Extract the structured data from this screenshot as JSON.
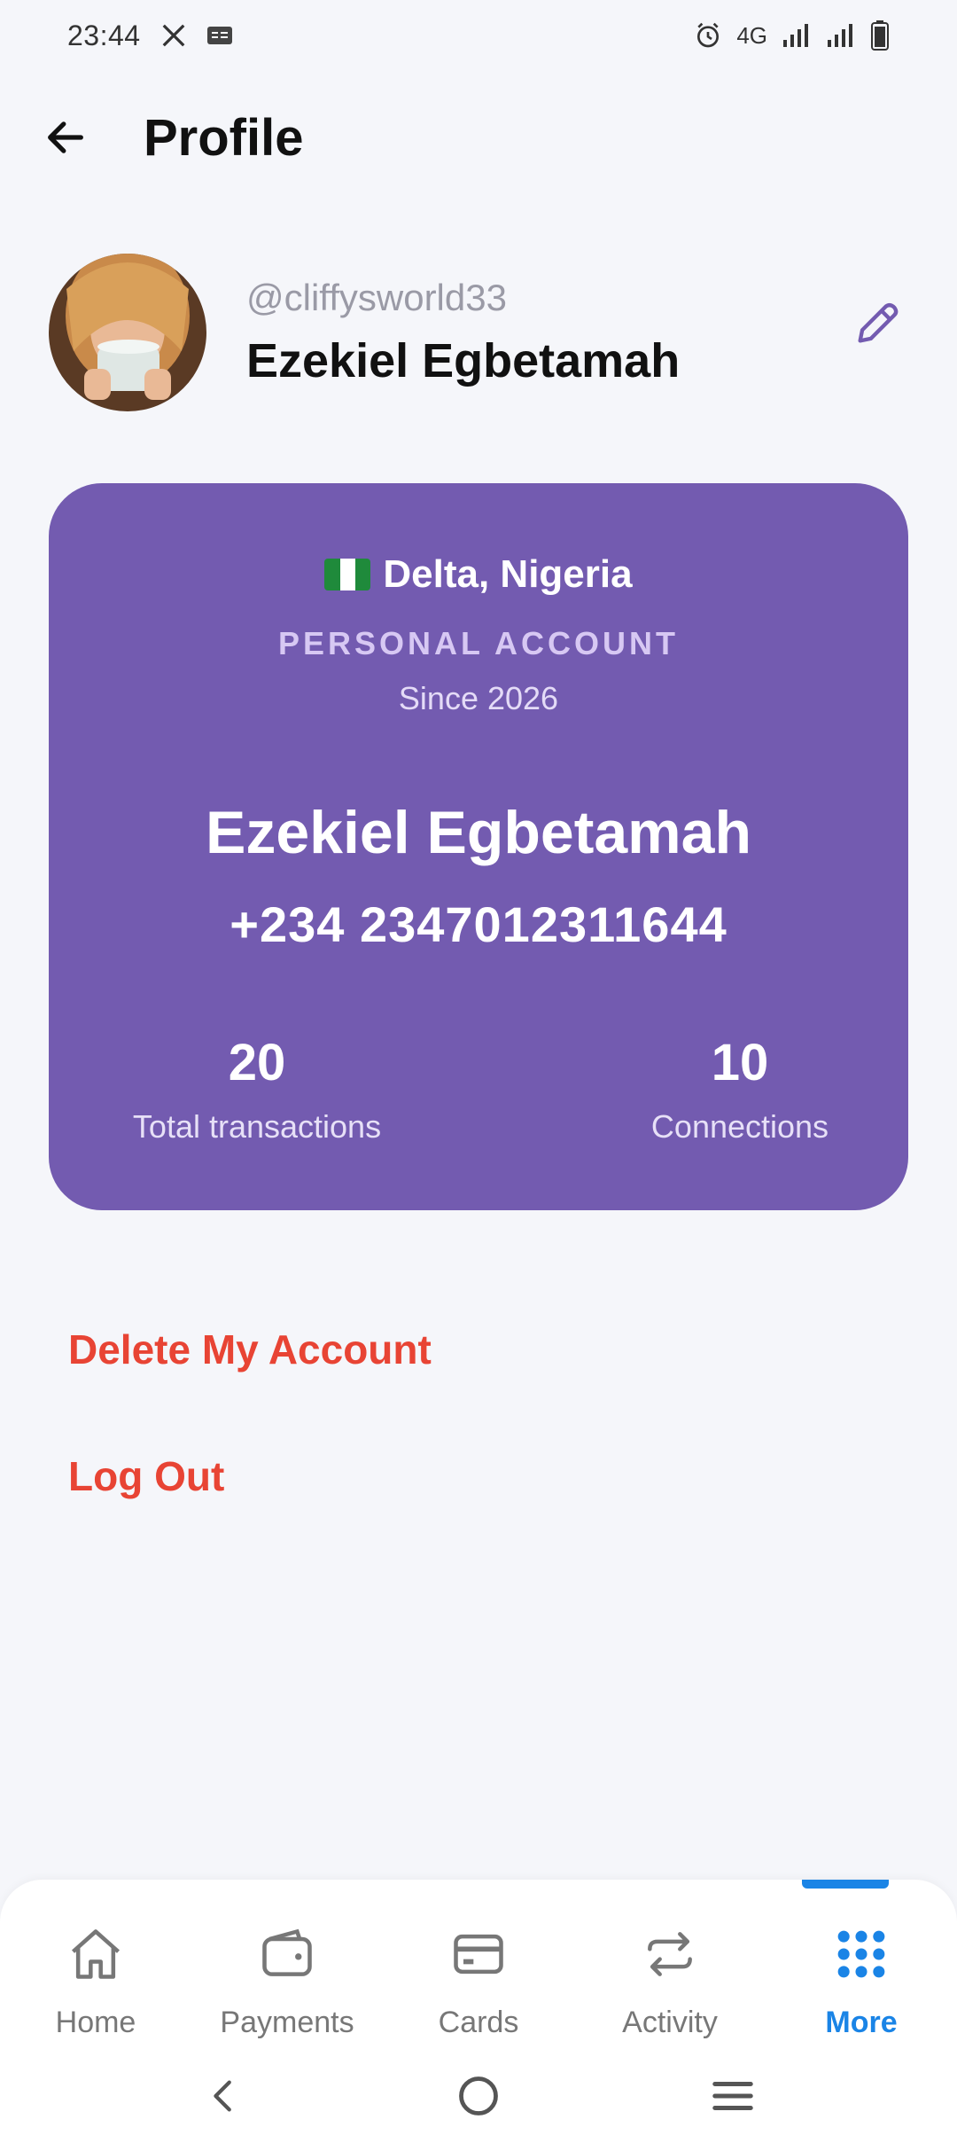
{
  "status_bar": {
    "time": "23:44",
    "network": "4G",
    "icons": [
      "x-logo-icon",
      "ge-icon",
      "alarm-icon",
      "signal-icon",
      "battery-icon"
    ]
  },
  "header": {
    "title": "Profile",
    "back_icon": "arrow-left-icon"
  },
  "profile": {
    "username": "@cliffysworld33",
    "full_name": "Ezekiel Egbetamah",
    "edit_icon": "pencil-icon"
  },
  "account_card": {
    "location": "Delta, Nigeria",
    "account_type": "PERSONAL ACCOUNT",
    "since": "Since 2026",
    "name": "Ezekiel Egbetamah",
    "phone": "+234 2347012311644",
    "stats": {
      "transactions_value": "20",
      "transactions_label": "Total transactions",
      "connections_value": "10",
      "connections_label": "Connections"
    },
    "background_color": "#735bb0"
  },
  "actions": {
    "delete_label": "Delete My Account",
    "logout_label": "Log Out",
    "color": "#e84434"
  },
  "bottom_nav": {
    "items": [
      {
        "label": "Home",
        "icon": "home-icon"
      },
      {
        "label": "Payments",
        "icon": "wallet-icon"
      },
      {
        "label": "Cards",
        "icon": "card-icon"
      },
      {
        "label": "Activity",
        "icon": "repeat-icon"
      },
      {
        "label": "More",
        "icon": "grid-dots-icon"
      }
    ],
    "active": "More",
    "active_color": "#1a84e6"
  },
  "system_nav": {
    "icons": [
      "back-chevron-icon",
      "home-circle-icon",
      "menu-lines-icon"
    ]
  }
}
